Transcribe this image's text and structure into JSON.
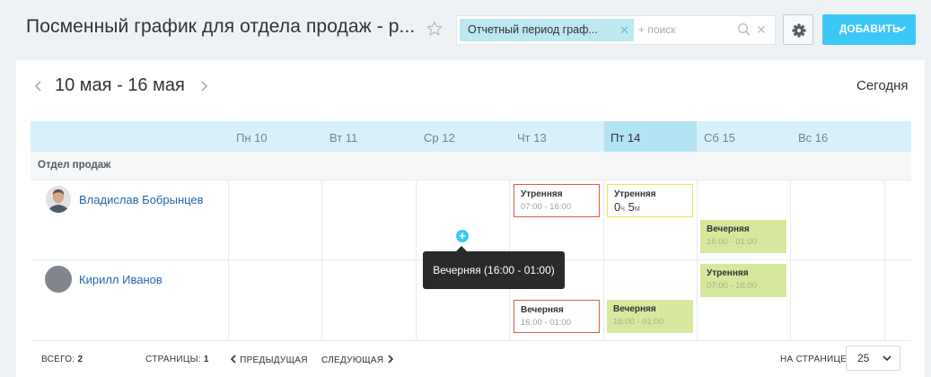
{
  "header": {
    "title": "Посменный график для отдела продаж - р...",
    "filter_tag": "Отчетный период граф...",
    "search_placeholder": "+ поиск",
    "add_button": "ДОБАВИТЬ"
  },
  "navigation": {
    "date_range": "10 мая - 16 мая",
    "today_label": "Сегодня"
  },
  "days": [
    "Пн 10",
    "Вт 11",
    "Ср 12",
    "Чт 13",
    "Пт 14",
    "Сб 15",
    "Вс 16"
  ],
  "department": "Отдел продаж",
  "employees": [
    {
      "name": "Владислав Бобрынцев",
      "shifts": [
        {
          "title": "Утренняя",
          "hours": "07:00 - 16:00"
        },
        {
          "title": "Утренняя",
          "duration_h": "0",
          "duration_h_unit": "ч",
          "duration_m": "5",
          "duration_m_unit": "м"
        },
        {
          "title": "Вечерняя",
          "hours": "16:00 - 01:00"
        }
      ]
    },
    {
      "name": "Кирилл Иванов",
      "shifts": [
        {
          "title": "Утренняя",
          "hours": "07:00 - 16:00"
        },
        {
          "title": "Вечерняя",
          "hours": "16:00 - 01:00"
        },
        {
          "title": "Вечерняя",
          "hours": "16:00 - 01:00"
        }
      ]
    }
  ],
  "tooltip": "Вечерняя (16:00 - 01:00)",
  "footer": {
    "total_label": "ВСЕГО:",
    "total_value": "2",
    "pages_label": "СТРАНИЦЫ:",
    "pages_value": "1",
    "prev": "ПРЕДЫДУЩАЯ",
    "next": "СЛЕДУЮЩАЯ",
    "per_page_label": "НА СТРАНИЦЕ:",
    "per_page_value": "25"
  },
  "colors": {
    "accent": "#3bc8f5",
    "header_row": "#d6f1fb",
    "today_column": "#b3e2f3",
    "shift_red_border": "#e55a4a",
    "shift_yellow_border": "#f2e64e",
    "shift_green": "#d6e89e",
    "link": "#2067b0"
  },
  "icons": {
    "star": "star-icon",
    "search": "search-icon",
    "clear": "close-icon",
    "settings": "gear-icon",
    "add_cell": "plus-circle-icon"
  }
}
